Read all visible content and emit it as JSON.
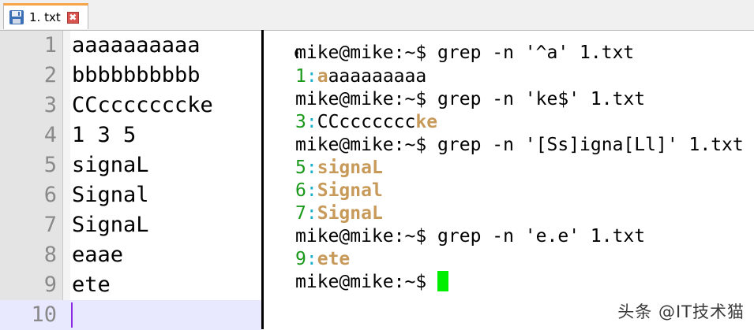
{
  "tab": {
    "title": "1. txt",
    "save_icon": "save-icon",
    "close_icon": "close-icon",
    "close_glyph": "✖",
    "accent": "#f7a34a"
  },
  "editor": {
    "lines": [
      {
        "num": "1",
        "text": "aaaaaaaaaa"
      },
      {
        "num": "2",
        "text": "bbbbbbbbbb"
      },
      {
        "num": "3",
        "text": "CCcccccccke"
      },
      {
        "num": "4",
        "text": "1 3 5"
      },
      {
        "num": "5",
        "text": "signaL"
      },
      {
        "num": "6",
        "text": "Signal"
      },
      {
        "num": "7",
        "text": "SignaL"
      },
      {
        "num": "8",
        "text": "eaae"
      },
      {
        "num": "9",
        "text": "ete"
      },
      {
        "num": "10",
        "text": ""
      }
    ],
    "current_line": "10"
  },
  "terminal": {
    "prompt": "mike@mike:~$",
    "commands": [
      "grep -n '^a' 1.txt",
      "grep -n 'ke$' 1.txt",
      "grep -n '[Ss]igna[Ll]' 1.txt",
      "grep -n 'e.e' 1.txt"
    ],
    "results": [
      {
        "num": "1",
        "match": "a",
        "rest": "aaaaaaaaa"
      },
      {
        "num": "3",
        "pre": "CCccccccc",
        "match": "ke"
      },
      {
        "num": "5",
        "match": "signaL"
      },
      {
        "num": "6",
        "match": "Signal"
      },
      {
        "num": "7",
        "match": "SignaL"
      },
      {
        "num": "9",
        "match": "ete"
      }
    ],
    "colors": {
      "line_number": "#1a9a1a",
      "separator": "#1ab0c8",
      "match": "#c89a5a",
      "cursor": "#00ee00"
    }
  },
  "watermark": "头条 @IT技术猫"
}
